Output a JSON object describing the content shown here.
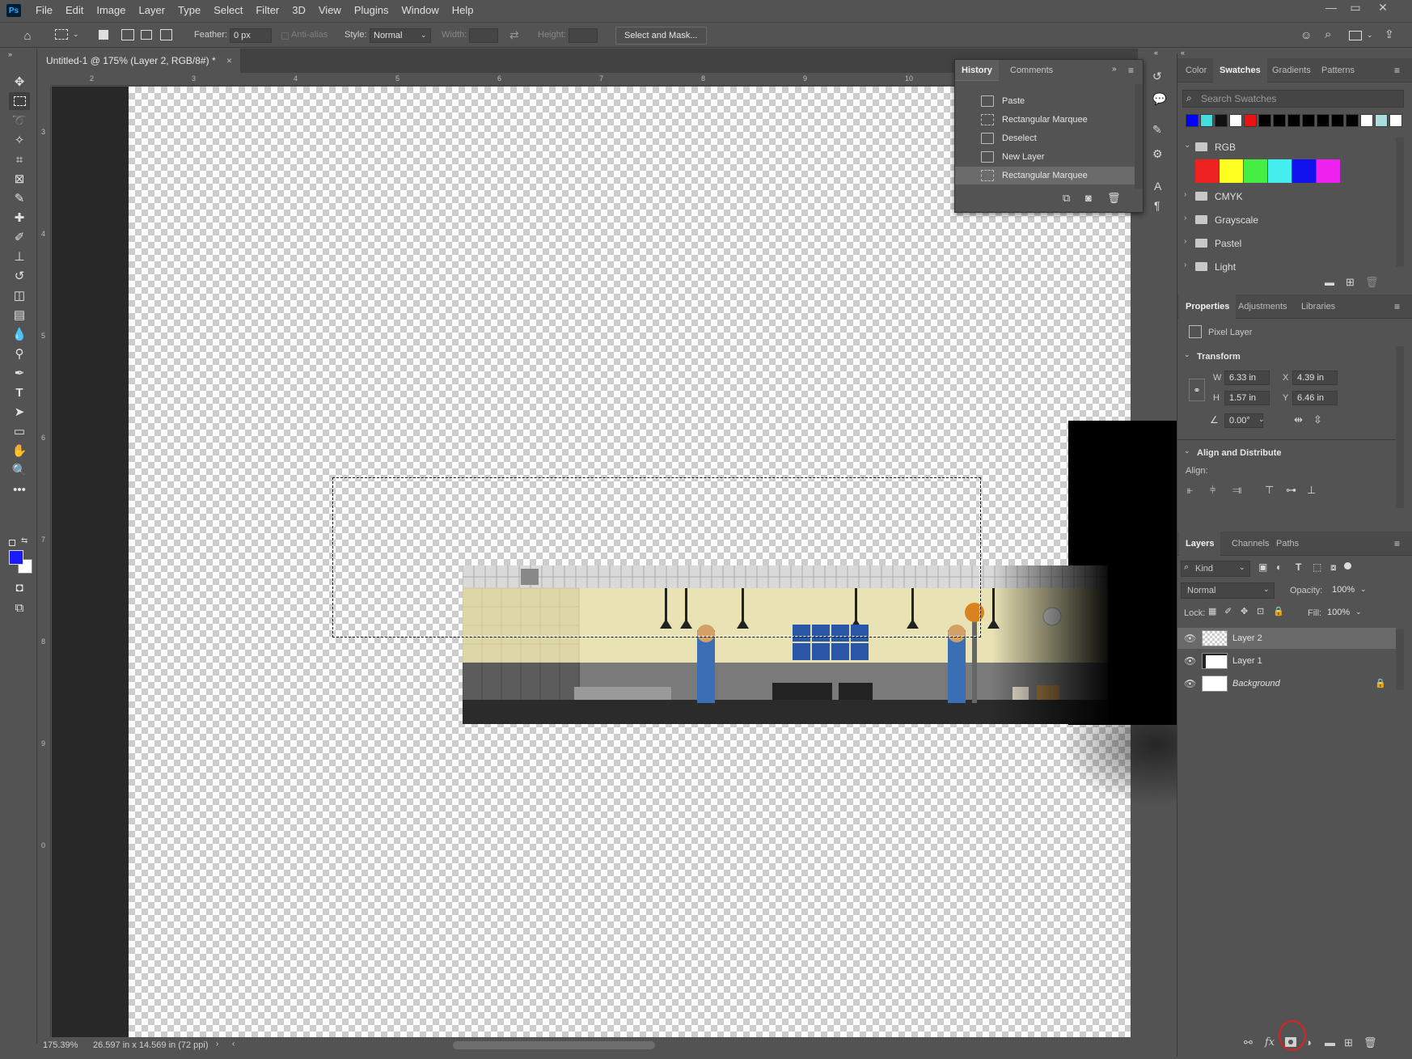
{
  "app": {
    "logo": "Ps"
  },
  "menu": [
    "File",
    "Edit",
    "Image",
    "Layer",
    "Type",
    "Select",
    "Filter",
    "3D",
    "View",
    "Plugins",
    "Window",
    "Help"
  ],
  "options": {
    "feather_label": "Feather:",
    "feather_value": "0 px",
    "antialias_label": "Anti-alias",
    "style_label": "Style:",
    "style_value": "Normal",
    "width_label": "Width:",
    "height_label": "Height:",
    "select_mask_label": "Select and Mask..."
  },
  "document": {
    "tab_title": "Untitled-1 @ 175% (Layer 2, RGB/8#) *",
    "close_glyph": "×"
  },
  "rulers": {
    "top": [
      "2",
      "3",
      "4",
      "5",
      "6",
      "7",
      "8",
      "9",
      "10"
    ],
    "left": [
      "3",
      "4",
      "5",
      "6",
      "7",
      "8",
      "9",
      "0"
    ]
  },
  "status": {
    "zoom": "175.39%",
    "doc_size": "26.597 in x 14.569 in (72 ppi)"
  },
  "history": {
    "tabs": [
      "History",
      "Comments"
    ],
    "items": [
      {
        "label": "Paste",
        "icon": "doc-icon",
        "selected": false
      },
      {
        "label": "Rectangular Marquee",
        "icon": "marquee-icon",
        "selected": false
      },
      {
        "label": "Deselect",
        "icon": "doc-icon",
        "selected": false
      },
      {
        "label": "New Layer",
        "icon": "doc-icon",
        "selected": false
      },
      {
        "label": "Rectangular Marquee",
        "icon": "marquee-icon",
        "selected": true
      }
    ]
  },
  "swatches_panel": {
    "tabs": [
      "Color",
      "Swatches",
      "Gradients",
      "Patterns"
    ],
    "search_placeholder": "Search Swatches",
    "recent": [
      "#0000ff",
      "#44dddd",
      "#111111",
      "#ffffff",
      "#ee1111",
      "#000000",
      "#000000",
      "#000000",
      "#000000",
      "#000000",
      "#000000",
      "#000000",
      "#ffffff",
      "#aadddd",
      "#ffffff"
    ],
    "rgb_group": "RGB",
    "rgb_colors": [
      "#ee2222",
      "#ffff22",
      "#44ee44",
      "#44eeee",
      "#1111ee",
      "#ee22ee"
    ],
    "groups": [
      "CMYK",
      "Grayscale",
      "Pastel",
      "Light"
    ]
  },
  "properties_panel": {
    "tabs": [
      "Properties",
      "Adjustments",
      "Libraries"
    ],
    "layer_type": "Pixel Layer",
    "transform_header": "Transform",
    "w_label": "W",
    "w_value": "6.33 in",
    "x_label": "X",
    "x_value": "4.39 in",
    "h_label": "H",
    "h_value": "1.57 in",
    "y_label": "Y",
    "y_value": "6.46 in",
    "angle_value": "0.00°",
    "align_header": "Align and Distribute",
    "align_label": "Align:"
  },
  "layers_panel": {
    "tabs": [
      "Layers",
      "Channels",
      "Paths"
    ],
    "filter_kind": "Kind",
    "blend_mode": "Normal",
    "opacity_label": "Opacity:",
    "opacity_value": "100%",
    "lock_label": "Lock:",
    "fill_label": "Fill:",
    "fill_value": "100%",
    "layers": [
      {
        "name": "Layer 2",
        "selected": true
      },
      {
        "name": "Layer 1",
        "selected": false
      },
      {
        "name": "Background",
        "selected": false,
        "locked": true
      }
    ]
  },
  "colors": {
    "foreground": "#1a1aff",
    "background": "#ffffff",
    "annotation_circle": "#e0201e"
  }
}
